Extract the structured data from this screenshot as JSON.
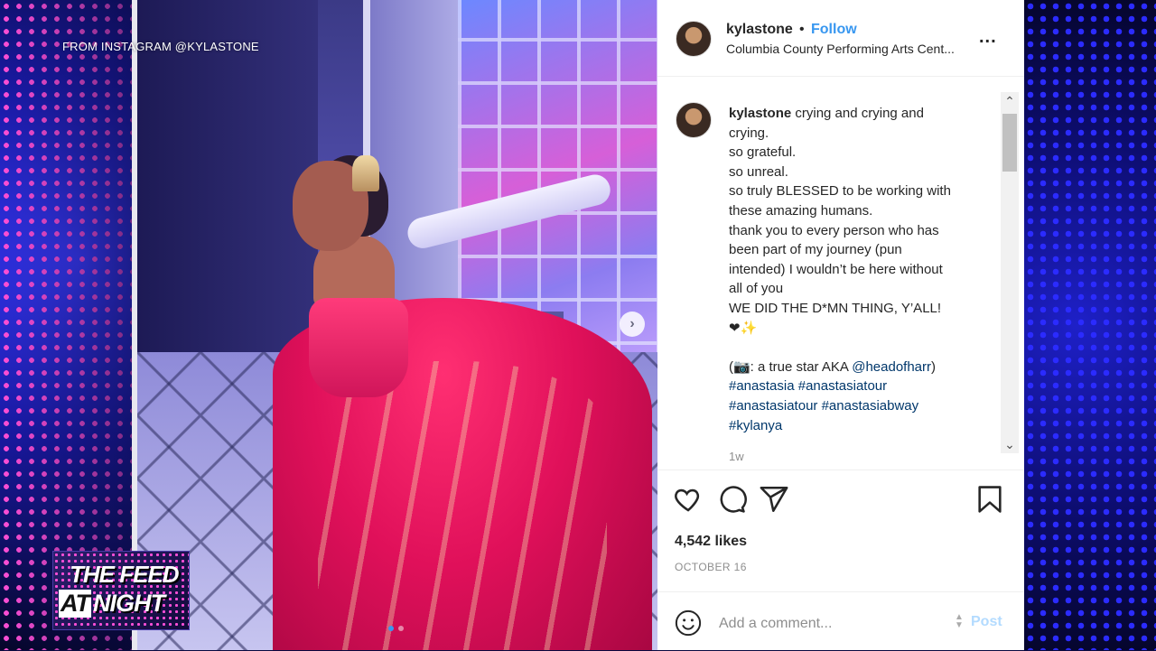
{
  "overlay": {
    "source_caption": "FROM INSTAGRAM @KYLASTONE",
    "show_logo": {
      "line1": "THE FEED",
      "line2_at": "AT",
      "line2_rest": "NIGHT"
    }
  },
  "post": {
    "header": {
      "username": "kylastone",
      "separator": "•",
      "follow_label": "Follow",
      "location": "Columbia County Performing Arts Cent...",
      "more_label": "..."
    },
    "caption": {
      "username": "kylastone",
      "lines": [
        "crying and crying and",
        "crying.",
        "so grateful.",
        "so unreal.",
        "so truly BLESSED to be working with",
        "these amazing humans.",
        "thank you to every person who has",
        "been part of my journey (pun",
        "intended) I wouldn’t be here without",
        "all of you",
        "WE DID THE D*MN THING, Y’ALL!",
        "❤✨"
      ],
      "credit_prefix": "(📷: a true star AKA ",
      "credit_mention": "@headofharr",
      "credit_suffix": ")",
      "hashtag_lines": [
        [
          "#anastasia",
          "#anastasiatour"
        ],
        [
          "#anastasiatour",
          "#anastasiabway"
        ],
        [
          "#kylanya"
        ]
      ],
      "time": "1w"
    },
    "likes": "4,542 likes",
    "date": "OCTOBER 16",
    "comment_placeholder": "Add a comment...",
    "post_label": "Post"
  },
  "colors": {
    "link_blue": "#3897f0",
    "hashtag": "#00376b",
    "post_disabled": "#b3dbff"
  },
  "icons": [
    "heart-icon",
    "comment-icon",
    "share-icon",
    "bookmark-icon",
    "smile-icon",
    "chevron-right-icon"
  ]
}
